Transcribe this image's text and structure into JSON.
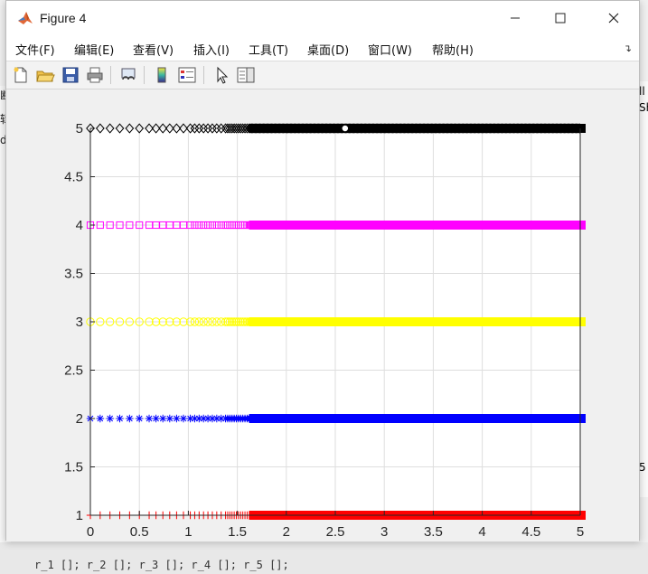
{
  "window": {
    "title": "Figure 4"
  },
  "menu": [
    "文件(F)",
    "编辑(E)",
    "查看(V)",
    "插入(I)",
    "工具(T)",
    "桌面(D)",
    "窗口(W)",
    "帮助(H)"
  ],
  "menu_overflow_icon": "chevron-right-icon",
  "toolbar": {
    "buttons": [
      {
        "name": "new-figure",
        "icon": "new-file-icon"
      },
      {
        "name": "open-file",
        "icon": "folder-open-icon"
      },
      {
        "name": "save-figure",
        "icon": "floppy-disk-icon"
      },
      {
        "name": "print-figure",
        "icon": "printer-icon"
      },
      {
        "name": "link-plot",
        "icon": "link-plot-icon"
      },
      {
        "name": "insert-colorbar",
        "icon": "colorbar-icon"
      },
      {
        "name": "insert-legend",
        "icon": "legend-icon"
      },
      {
        "name": "edit-plot",
        "icon": "pointer-arrow-icon"
      },
      {
        "name": "property-inspector",
        "icon": "property-inspector-icon"
      }
    ]
  },
  "background": {
    "left_fragments": [
      "断",
      "辑",
      "di"
    ],
    "right_fragments": [
      "ll",
      "Sh",
      "5"
    ],
    "bottom_code": "r_1 []; r_2 []; r_3 []; r_4 []; r_5 [];"
  },
  "chart_data": {
    "type": "scatter",
    "title": "",
    "xlabel": "",
    "ylabel": "",
    "xlim": [
      0,
      5
    ],
    "ylim": [
      1,
      5
    ],
    "xticks": [
      "0",
      "0.5",
      "1",
      "1.5",
      "2",
      "2.5",
      "3",
      "3.5",
      "4",
      "4.5",
      "5"
    ],
    "yticks": [
      "1",
      "1.5",
      "2",
      "2.5",
      "3",
      "3.5",
      "4",
      "4.5",
      "5"
    ],
    "grid": true,
    "legend": "none",
    "series": [
      {
        "y": 1,
        "marker": "plus",
        "color": "#ff0000",
        "x_start": 0,
        "x_end": 5
      },
      {
        "y": 2,
        "marker": "asterisk",
        "color": "#0000ff",
        "x_start": 0,
        "x_end": 5
      },
      {
        "y": 3,
        "marker": "circle",
        "color": "#ffff00",
        "x_start": 0,
        "x_end": 5
      },
      {
        "y": 4,
        "marker": "square",
        "color": "#ff00ff",
        "x_start": 0,
        "x_end": 5
      },
      {
        "y": 5,
        "marker": "diamond",
        "color": "#000000",
        "x_start": 0,
        "x_end": 5
      }
    ],
    "annotations": [
      {
        "type": "datatip-marker",
        "x": 2.6,
        "y": 5
      }
    ]
  }
}
